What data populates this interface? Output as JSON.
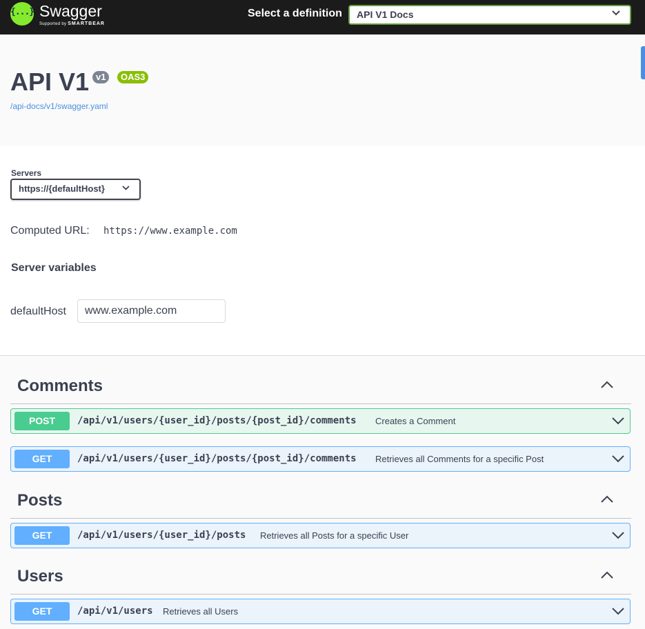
{
  "topbar": {
    "logo_symbol": "{...}",
    "logo_title": "Swagger",
    "logo_sub_prefix": "Supported by",
    "logo_sub_brand": "SMARTBEAR",
    "definition_label": "Select a definition",
    "definition_value": "API V1 Docs"
  },
  "info": {
    "title": "API V1",
    "version_badge": "v1",
    "oas_badge": "OAS3",
    "spec_link": "/api-docs/v1/swagger.yaml"
  },
  "servers": {
    "label": "Servers",
    "selected": "https://{defaultHost}",
    "computed_label": "Computed URL:",
    "computed_url": "https://www.example.com",
    "variables_heading": "Server variables",
    "variable_name": "defaultHost",
    "variable_value": "www.example.com"
  },
  "tags": [
    {
      "name": "Comments",
      "operations": [
        {
          "method": "POST",
          "path": "/api/v1/users/{user_id}/posts/{post_id}/comments",
          "summary": "Creates a Comment"
        },
        {
          "method": "GET",
          "path": "/api/v1/users/{user_id}/posts/{post_id}/comments",
          "summary": "Retrieves all Comments for a specific Post"
        }
      ]
    },
    {
      "name": "Posts",
      "operations": [
        {
          "method": "GET",
          "path": "/api/v1/users/{user_id}/posts",
          "summary": "Retrieves all Posts for a specific User"
        }
      ]
    },
    {
      "name": "Users",
      "operations": [
        {
          "method": "GET",
          "path": "/api/v1/users",
          "summary": "Retrieves all Users"
        }
      ]
    }
  ],
  "colors": {
    "post": "#49cc90",
    "get": "#61affe",
    "brand": "#85ea2d",
    "link": "#4990e2"
  },
  "icons": {
    "collapse": "chevron-up-icon",
    "expand": "chevron-down-icon"
  }
}
